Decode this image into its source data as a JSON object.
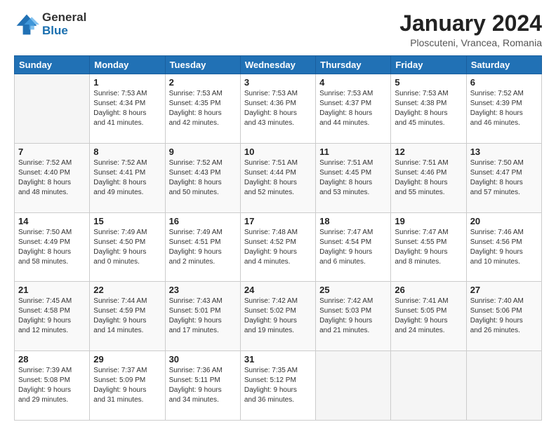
{
  "logo": {
    "general": "General",
    "blue": "Blue"
  },
  "header": {
    "title": "January 2024",
    "subtitle": "Ploscuteni, Vrancea, Romania"
  },
  "weekdays": [
    "Sunday",
    "Monday",
    "Tuesday",
    "Wednesday",
    "Thursday",
    "Friday",
    "Saturday"
  ],
  "weeks": [
    [
      {
        "day": "",
        "info": ""
      },
      {
        "day": "1",
        "info": "Sunrise: 7:53 AM\nSunset: 4:34 PM\nDaylight: 8 hours\nand 41 minutes."
      },
      {
        "day": "2",
        "info": "Sunrise: 7:53 AM\nSunset: 4:35 PM\nDaylight: 8 hours\nand 42 minutes."
      },
      {
        "day": "3",
        "info": "Sunrise: 7:53 AM\nSunset: 4:36 PM\nDaylight: 8 hours\nand 43 minutes."
      },
      {
        "day": "4",
        "info": "Sunrise: 7:53 AM\nSunset: 4:37 PM\nDaylight: 8 hours\nand 44 minutes."
      },
      {
        "day": "5",
        "info": "Sunrise: 7:53 AM\nSunset: 4:38 PM\nDaylight: 8 hours\nand 45 minutes."
      },
      {
        "day": "6",
        "info": "Sunrise: 7:52 AM\nSunset: 4:39 PM\nDaylight: 8 hours\nand 46 minutes."
      }
    ],
    [
      {
        "day": "7",
        "info": "Sunrise: 7:52 AM\nSunset: 4:40 PM\nDaylight: 8 hours\nand 48 minutes."
      },
      {
        "day": "8",
        "info": "Sunrise: 7:52 AM\nSunset: 4:41 PM\nDaylight: 8 hours\nand 49 minutes."
      },
      {
        "day": "9",
        "info": "Sunrise: 7:52 AM\nSunset: 4:43 PM\nDaylight: 8 hours\nand 50 minutes."
      },
      {
        "day": "10",
        "info": "Sunrise: 7:51 AM\nSunset: 4:44 PM\nDaylight: 8 hours\nand 52 minutes."
      },
      {
        "day": "11",
        "info": "Sunrise: 7:51 AM\nSunset: 4:45 PM\nDaylight: 8 hours\nand 53 minutes."
      },
      {
        "day": "12",
        "info": "Sunrise: 7:51 AM\nSunset: 4:46 PM\nDaylight: 8 hours\nand 55 minutes."
      },
      {
        "day": "13",
        "info": "Sunrise: 7:50 AM\nSunset: 4:47 PM\nDaylight: 8 hours\nand 57 minutes."
      }
    ],
    [
      {
        "day": "14",
        "info": "Sunrise: 7:50 AM\nSunset: 4:49 PM\nDaylight: 8 hours\nand 58 minutes."
      },
      {
        "day": "15",
        "info": "Sunrise: 7:49 AM\nSunset: 4:50 PM\nDaylight: 9 hours\nand 0 minutes."
      },
      {
        "day": "16",
        "info": "Sunrise: 7:49 AM\nSunset: 4:51 PM\nDaylight: 9 hours\nand 2 minutes."
      },
      {
        "day": "17",
        "info": "Sunrise: 7:48 AM\nSunset: 4:52 PM\nDaylight: 9 hours\nand 4 minutes."
      },
      {
        "day": "18",
        "info": "Sunrise: 7:47 AM\nSunset: 4:54 PM\nDaylight: 9 hours\nand 6 minutes."
      },
      {
        "day": "19",
        "info": "Sunrise: 7:47 AM\nSunset: 4:55 PM\nDaylight: 9 hours\nand 8 minutes."
      },
      {
        "day": "20",
        "info": "Sunrise: 7:46 AM\nSunset: 4:56 PM\nDaylight: 9 hours\nand 10 minutes."
      }
    ],
    [
      {
        "day": "21",
        "info": "Sunrise: 7:45 AM\nSunset: 4:58 PM\nDaylight: 9 hours\nand 12 minutes."
      },
      {
        "day": "22",
        "info": "Sunrise: 7:44 AM\nSunset: 4:59 PM\nDaylight: 9 hours\nand 14 minutes."
      },
      {
        "day": "23",
        "info": "Sunrise: 7:43 AM\nSunset: 5:01 PM\nDaylight: 9 hours\nand 17 minutes."
      },
      {
        "day": "24",
        "info": "Sunrise: 7:42 AM\nSunset: 5:02 PM\nDaylight: 9 hours\nand 19 minutes."
      },
      {
        "day": "25",
        "info": "Sunrise: 7:42 AM\nSunset: 5:03 PM\nDaylight: 9 hours\nand 21 minutes."
      },
      {
        "day": "26",
        "info": "Sunrise: 7:41 AM\nSunset: 5:05 PM\nDaylight: 9 hours\nand 24 minutes."
      },
      {
        "day": "27",
        "info": "Sunrise: 7:40 AM\nSunset: 5:06 PM\nDaylight: 9 hours\nand 26 minutes."
      }
    ],
    [
      {
        "day": "28",
        "info": "Sunrise: 7:39 AM\nSunset: 5:08 PM\nDaylight: 9 hours\nand 29 minutes."
      },
      {
        "day": "29",
        "info": "Sunrise: 7:37 AM\nSunset: 5:09 PM\nDaylight: 9 hours\nand 31 minutes."
      },
      {
        "day": "30",
        "info": "Sunrise: 7:36 AM\nSunset: 5:11 PM\nDaylight: 9 hours\nand 34 minutes."
      },
      {
        "day": "31",
        "info": "Sunrise: 7:35 AM\nSunset: 5:12 PM\nDaylight: 9 hours\nand 36 minutes."
      },
      {
        "day": "",
        "info": ""
      },
      {
        "day": "",
        "info": ""
      },
      {
        "day": "",
        "info": ""
      }
    ]
  ]
}
